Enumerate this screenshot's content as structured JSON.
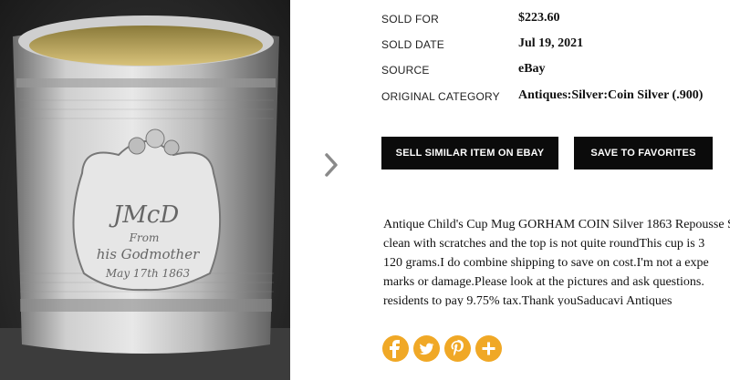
{
  "colors": {
    "button_bg": "#0b0b0b",
    "social_orange": "#f0a826",
    "text": "#111111"
  },
  "photo": {
    "alt": "Engraved silver child's cup",
    "engraving": [
      "JMcD",
      "From",
      "his Godmother",
      "May 17th 1863"
    ]
  },
  "details": {
    "sold_for": {
      "label": "SOLD FOR",
      "value": "$223.60"
    },
    "sold_date": {
      "label": "SOLD DATE",
      "value": "Jul 19, 2021"
    },
    "source": {
      "label": "SOURCE",
      "value": "eBay"
    },
    "category": {
      "label": "ORIGINAL CATEGORY",
      "value": "Antiques:Silver:Coin Silver (.900)"
    }
  },
  "buttons": {
    "sell_similar": "SELL SIMILAR ITEM ON EBAY",
    "save_favorites": "SAVE TO FAVORITES"
  },
  "description": {
    "lines": [
      "Antique Child's Cup Mug GORHAM COIN Silver 1863 Repousse S",
      "clean with scratches and the top is not quite roundThis cup is 3",
      "120 grams.I do combine shipping to save on cost.I'm not a expe",
      "marks or damage.Please look at the pictures and ask questions.",
      "residents to pay 9.75% tax.Thank youSaducavi Antiques"
    ]
  },
  "social": [
    "facebook-icon",
    "twitter-icon",
    "pinterest-icon",
    "more-share-icon"
  ]
}
